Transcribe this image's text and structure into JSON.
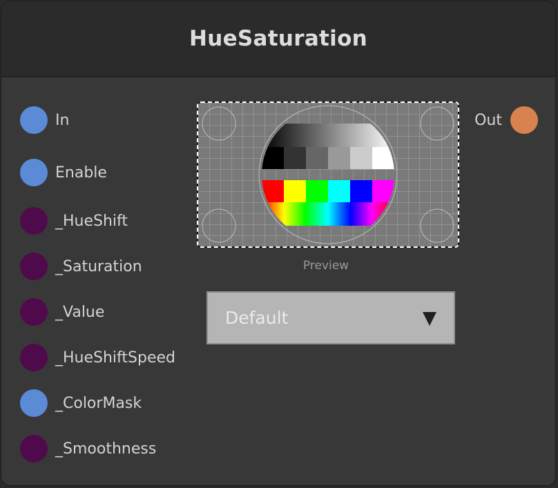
{
  "node": {
    "title": "HueSaturation"
  },
  "inputs": [
    {
      "label": "In",
      "color": "#5b8ad6"
    },
    {
      "label": "Enable",
      "color": "#5b8ad6"
    },
    {
      "label": "_HueShift",
      "color": "#4f0a4c"
    },
    {
      "label": "_Saturation",
      "color": "#4f0a4c"
    },
    {
      "label": "_Value",
      "color": "#4f0a4c"
    },
    {
      "label": "_HueShiftSpeed",
      "color": "#4f0a4c"
    },
    {
      "label": "_ColorMask",
      "color": "#5b8ad6"
    },
    {
      "label": "_Smoothness",
      "color": "#4f0a4c"
    }
  ],
  "outputs": [
    {
      "label": "Out",
      "color": "#d8834f"
    }
  ],
  "preview": {
    "label": "Preview",
    "image": "test-pattern-icon"
  },
  "dropdown": {
    "value": "Default",
    "icon": "triangle-down-icon"
  }
}
